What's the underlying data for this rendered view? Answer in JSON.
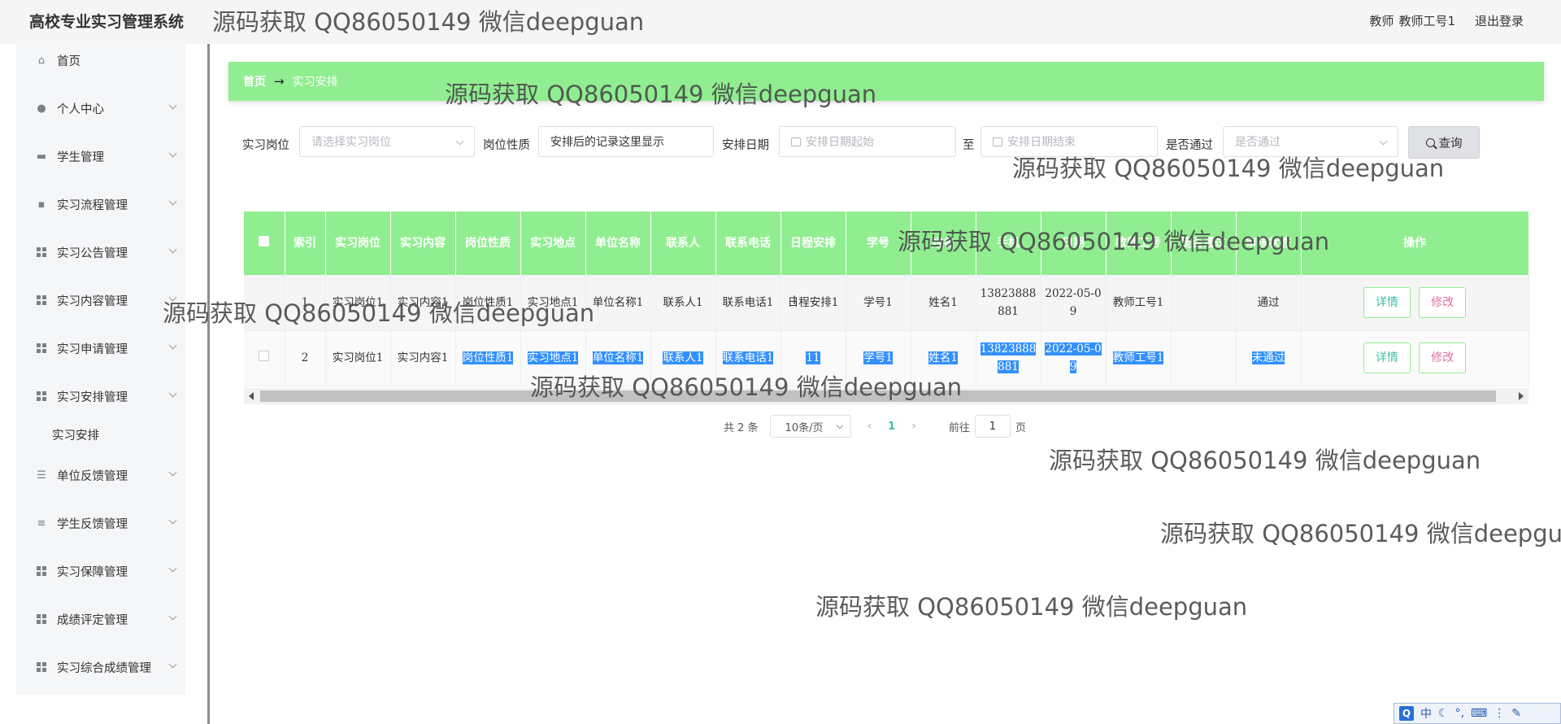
{
  "header": {
    "app_title": "高校专业实习管理系统",
    "user_role": "教师",
    "user_name": "教师工号1",
    "logout": "退出登录"
  },
  "sidebar": {
    "items": [
      {
        "label": "首页",
        "icon": "home-icon"
      },
      {
        "label": "个人中心",
        "icon": "person-icon"
      },
      {
        "label": "学生管理",
        "icon": "briefcase-icon"
      },
      {
        "label": "实习流程管理",
        "icon": "chat-icon"
      },
      {
        "label": "实习公告管理",
        "icon": "grid-icon"
      },
      {
        "label": "实习内容管理",
        "icon": "grid-icon"
      },
      {
        "label": "实习申请管理",
        "icon": "grid-icon"
      },
      {
        "label": "实习安排管理",
        "icon": "grid-icon"
      },
      {
        "label": "单位反馈管理",
        "icon": "list-icon"
      },
      {
        "label": "学生反馈管理",
        "icon": "lines-icon"
      },
      {
        "label": "实习保障管理",
        "icon": "grid-icon"
      },
      {
        "label": "成绩评定管理",
        "icon": "grid-icon"
      },
      {
        "label": "实习综合成绩管理",
        "icon": "grid-icon"
      }
    ],
    "sub_item": "实习安排"
  },
  "breadcrumb": {
    "home": "首页",
    "arrow": "→",
    "current": "实习安排"
  },
  "filters": {
    "position_label": "实习岗位",
    "position_placeholder": "请选择实习岗位",
    "nature_label": "岗位性质",
    "nature_value": "安排后的记录这里显示",
    "date_label": "安排日期",
    "date_start_placeholder": "安排日期起始",
    "date_to": "至",
    "date_end_placeholder": "安排日期结束",
    "pass_label": "是否通过",
    "pass_placeholder": "是否通过",
    "query_button": "查询"
  },
  "table": {
    "headers": [
      "索引",
      "实习岗位",
      "实习内容",
      "岗位性质",
      "实习地点",
      "单位名称",
      "联系人",
      "联系电话",
      "日程安排",
      "学号",
      "姓名",
      "手机",
      "日期",
      "教师工号",
      "是否通过",
      "审核状态",
      "操作"
    ],
    "rows": [
      {
        "index": "1",
        "position": "实习岗位1",
        "content": "实习内容1",
        "nature": "岗位性质1",
        "place": "实习地点1",
        "company": "单位名称1",
        "contact": "联系人1",
        "phone": "联系电话1",
        "schedule": "日程安排1",
        "student_no": "学号1",
        "name": "姓名1",
        "mobile": "13823888881",
        "date": "2022-05-09",
        "teacher_no": "教师工号1",
        "pass": "",
        "status": "通过"
      },
      {
        "index": "2",
        "position": "实习岗位1",
        "content": "实习内容1",
        "nature": "岗位性质1",
        "place": "实习地点1",
        "company": "单位名称1",
        "contact": "联系人1",
        "phone": "联系电话1",
        "schedule": "11",
        "student_no": "学号1",
        "name": "姓名1",
        "mobile": "13823888881",
        "date": "2022-05-09",
        "teacher_no": "教师工号1",
        "pass": "",
        "status": "未通过"
      }
    ],
    "detail_button": "详情",
    "edit_button": "修改"
  },
  "pager": {
    "total": "共 2 条",
    "page_size": "10条/页",
    "current_page": "1",
    "goto_prefix": "前往",
    "goto_value": "1",
    "goto_suffix": "页"
  },
  "watermark": "源码获取 QQ86050149 微信deepguan",
  "ime": {
    "logo": "Q",
    "mode": "中"
  },
  "colors": {
    "accent_green": "#90ee90",
    "selection_blue": "#3390ff"
  }
}
